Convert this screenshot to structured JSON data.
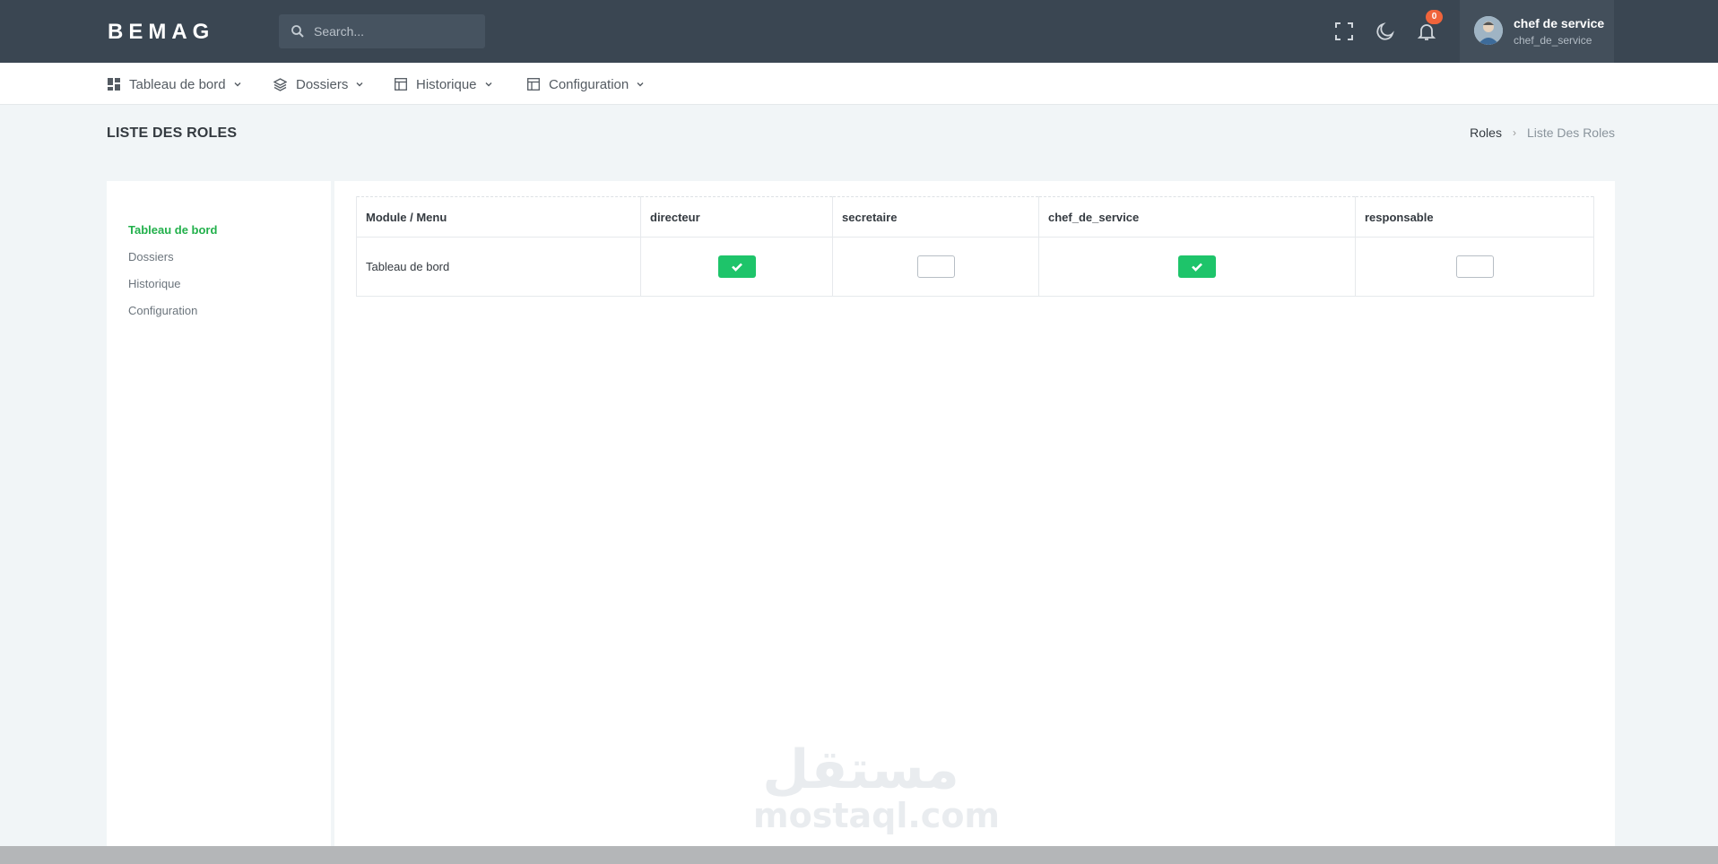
{
  "header": {
    "brand": "BEMAG",
    "search_placeholder": "Search...",
    "notification_count": "0",
    "user": {
      "name": "chef de service",
      "role": "chef_de_service"
    },
    "icons": [
      "search-icon",
      "fullscreen-icon",
      "moon-icon",
      "bell-icon"
    ]
  },
  "menu": {
    "items": [
      {
        "label": "Tableau de bord",
        "icon": "dashboard-icon"
      },
      {
        "label": "Dossiers",
        "icon": "layers-icon"
      },
      {
        "label": "Historique",
        "icon": "layout-icon"
      },
      {
        "label": "Configuration",
        "icon": "layout-icon"
      }
    ]
  },
  "page": {
    "title": "LISTE DES ROLES",
    "breadcrumb": [
      "Roles",
      "Liste Des Roles"
    ]
  },
  "sidebar": {
    "items": [
      "Tableau de bord",
      "Dossiers",
      "Historique",
      "Configuration"
    ],
    "active_index": 0
  },
  "table": {
    "headers": [
      "Module / Menu",
      "directeur",
      "secretaire",
      "chef_de_service",
      "responsable"
    ],
    "rows": [
      {
        "module": "Tableau de bord",
        "directeur": true,
        "secretaire": false,
        "chef_de_service": true,
        "responsable": false
      }
    ]
  },
  "watermark": {
    "arabic": "مستقل",
    "latin": "mostaql.com"
  },
  "colors": {
    "topbar": "#3a4652",
    "accent_green": "#1ec46a",
    "active_link": "#22b04b",
    "badge": "#f0643b"
  }
}
